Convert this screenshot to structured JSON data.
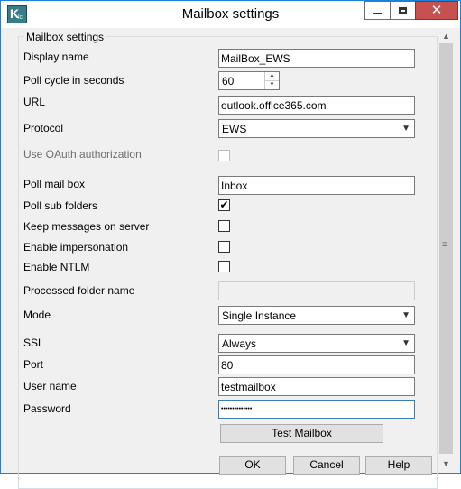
{
  "window": {
    "title": "Mailbox settings"
  },
  "group_title": "Mailbox settings",
  "fields": {
    "display_name": {
      "label": "Display name",
      "value": "MailBox_EWS"
    },
    "poll_cycle": {
      "label": "Poll cycle in seconds",
      "value": "60"
    },
    "url": {
      "label": "URL",
      "value": "outlook.office365.com"
    },
    "protocol": {
      "label": "Protocol",
      "value": "EWS"
    },
    "oauth": {
      "label": "Use OAuth authorization",
      "checked": false,
      "enabled": false
    },
    "poll_mailbox": {
      "label": "Poll mail box",
      "value": "Inbox"
    },
    "poll_subfolders": {
      "label": "Poll sub folders",
      "checked": true
    },
    "keep_messages": {
      "label": "Keep messages on server",
      "checked": false
    },
    "impersonation": {
      "label": "Enable impersonation",
      "checked": false
    },
    "ntlm": {
      "label": "Enable NTLM",
      "checked": false
    },
    "processed_folder": {
      "label": "Processed folder name",
      "value": ""
    },
    "mode": {
      "label": "Mode",
      "value": "Single Instance"
    },
    "ssl": {
      "label": "SSL",
      "value": "Always"
    },
    "port": {
      "label": "Port",
      "value": "80"
    },
    "user_name": {
      "label": "User name",
      "value": "testmailbox"
    },
    "password": {
      "label": "Password",
      "value": "••••••••••••••"
    }
  },
  "buttons": {
    "test": "Test Mailbox",
    "ok": "OK",
    "cancel": "Cancel",
    "help": "Help"
  },
  "checkmark": "✔",
  "icons": {
    "app": "app-icon",
    "minimize": "minimize-icon",
    "maximize": "maximize-icon",
    "close": "close-icon"
  },
  "colors": {
    "title_border": "#1883d7",
    "close_button": "#c75050"
  }
}
